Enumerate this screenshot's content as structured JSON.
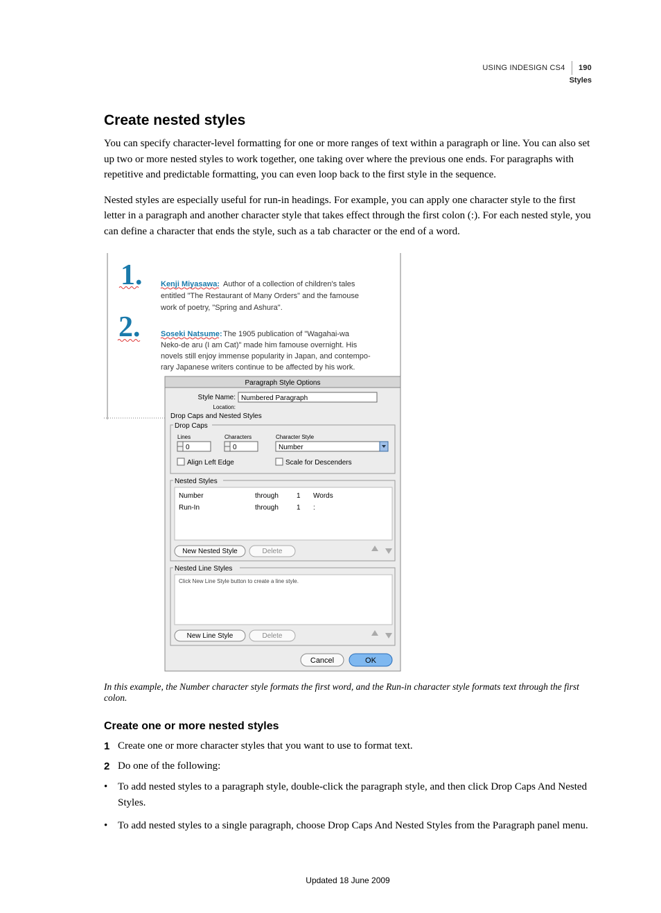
{
  "running_head": {
    "product": "USING INDESIGN CS4",
    "page_num": "190",
    "section": "Styles"
  },
  "h1": "Create nested styles",
  "para1": "You can specify character-level formatting for one or more ranges of text within a paragraph or line. You can also set up two or more nested styles to work together, one taking over where the previous one ends. For paragraphs with repetitive and predictable formatting, you can even loop back to the first style in the sequence.",
  "para2": "Nested styles are especially useful for run-in headings. For example, you can apply one character style to the first letter in a paragraph and another character style that takes effect through the first colon (:). For each nested style, you can define a character that ends the style, such as a tab character or the end of a word.",
  "figure": {
    "sample1_name": "Kenji Miyasawa:",
    "sample1_rest": " Author of a collection of children's tales entitled \"The Restaurant of Many Orders\" and the famouse work of poetry, \"Spring and Ashura\".",
    "sample2_name": "Soseki Natsume:",
    "sample2_rest": " The 1905 publication of \"Wagahai-wa Neko-de aru (I am Cat)\" made him famouse overnight. His novels still enjoy immense popularity in Japan, and contempo- rary Japanese writers continue to be affected by his work.",
    "panel_title": "Paragraph Style Options",
    "style_name_label": "Style Name:",
    "style_name_value": "Numbered Paragraph",
    "location_label": "Location:",
    "section_label": "Drop Caps and Nested Styles",
    "dropcaps_heading": "Drop Caps",
    "lines_label": "Lines",
    "chars_label": "Characters",
    "charstyle_label": "Character Style",
    "lines_value": "0",
    "chars_value": "0",
    "charstyle_value": "Number",
    "align_left_label": "Align Left Edge",
    "scale_desc_label": "Scale for Descenders",
    "nested_heading": "Nested Styles",
    "rows": [
      {
        "style": "Number",
        "through": "through",
        "count": "1",
        "unit": "Words"
      },
      {
        "style": "Run-In",
        "through": "through",
        "count": "1",
        "unit": ":"
      }
    ],
    "new_nested_btn": "New Nested Style",
    "delete_btn": "Delete",
    "line_heading": "Nested Line Styles",
    "line_hint": "Click New Line Style button to create a line style.",
    "new_line_btn": "New Line Style",
    "cancel_btn": "Cancel",
    "ok_btn": "OK"
  },
  "caption": "In this example, the Number character style formats the first word, and the Run-in character style formats text through the first colon.",
  "h2": "Create one or more nested styles",
  "step1": "Create one or more character styles that you want to use to format text.",
  "step2": "Do one of the following:",
  "bullet1": "To add nested styles to a paragraph style, double-click the paragraph style, and then click Drop Caps And Nested Styles.",
  "bullet2": "To add nested styles to a single paragraph, choose Drop Caps And Nested Styles from the Paragraph panel menu.",
  "footer": "Updated 18 June 2009"
}
